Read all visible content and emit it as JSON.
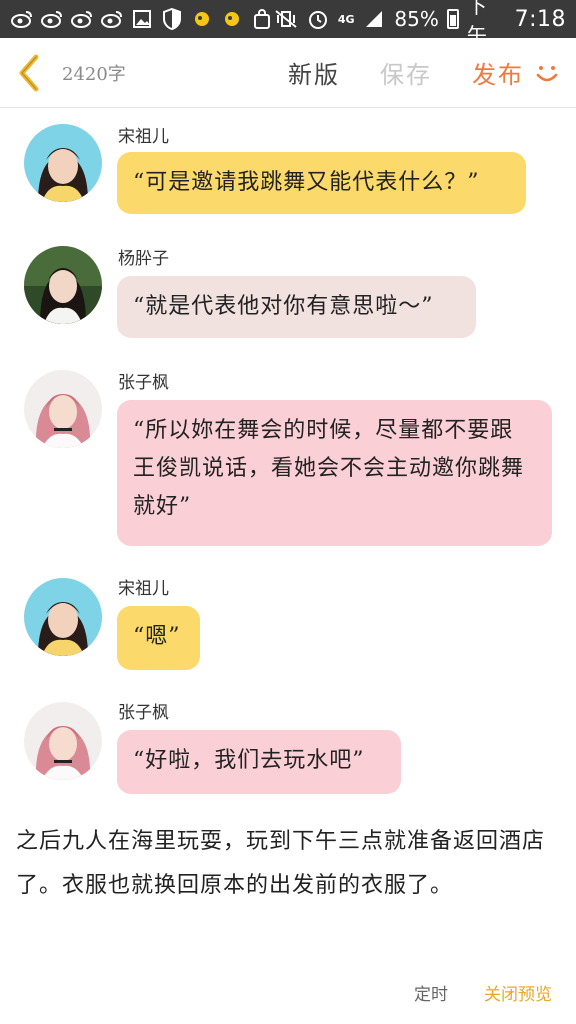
{
  "status_bar": {
    "network": "4G",
    "battery": "85%",
    "time_label": "下午",
    "time": "7:18"
  },
  "toolbar": {
    "word_count": "2420字",
    "new_label": "新版",
    "save_label": "保存",
    "publish_label": "发布",
    "accent_color": "#ef7a3e",
    "disabled_color": "#c8c8c8"
  },
  "messages": [
    {
      "sender": "宋祖儿",
      "text": "“可是邀请我跳舞又能代表什么？”",
      "bubble_color": "#fbd96a"
    },
    {
      "sender": "杨肸子",
      "text": "“就是代表他对你有意思啦～”",
      "bubble_color": "#f1e1df"
    },
    {
      "sender": "张子枫",
      "text": "“所以妳在舞会的时候，尽量都不要跟王俊凯说话，看她会不会主动邀你跳舞就好”",
      "bubble_color": "#fbcfd6"
    },
    {
      "sender": "宋祖儿",
      "text": "“嗯”",
      "bubble_color": "#fbd96a"
    },
    {
      "sender": "张子枫",
      "text": "“好啦，我们去玩水吧”",
      "bubble_color": "#fbcfd6"
    }
  ],
  "narration": "之后九人在海里玩耍，玩到下午三点就准备返回酒店了。衣服也就换回原本的出发前的衣服了。",
  "footer": {
    "schedule_label": "定时",
    "close_preview_label": "关闭预览"
  }
}
